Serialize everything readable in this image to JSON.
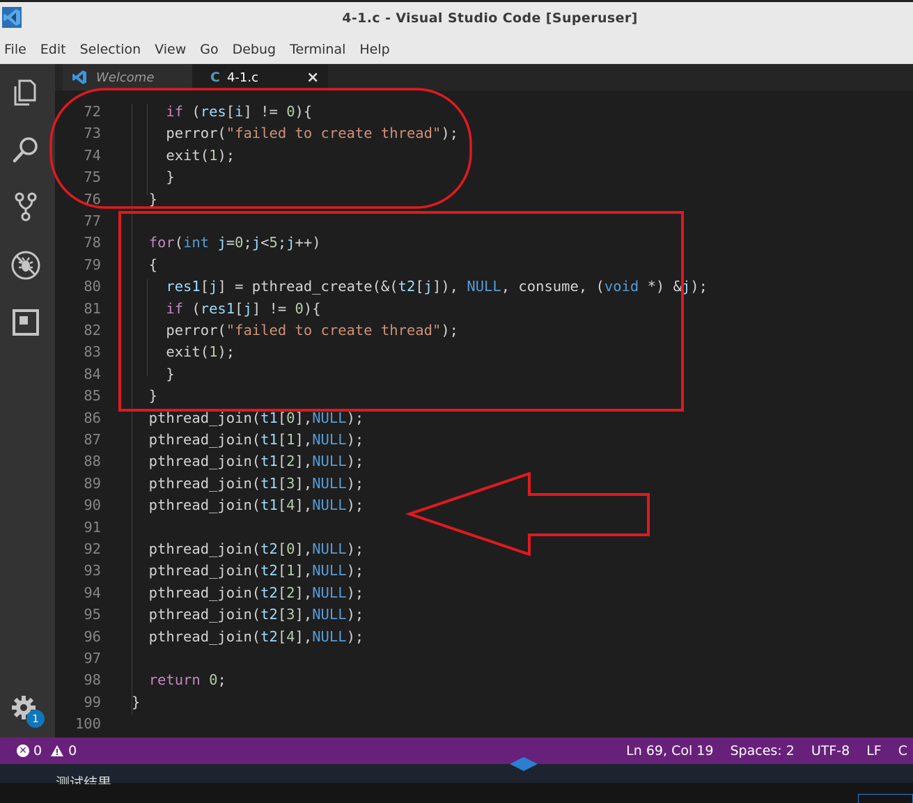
{
  "window": {
    "title": "4-1.c - Visual Studio Code [Superuser]"
  },
  "menu": [
    "File",
    "Edit",
    "Selection",
    "View",
    "Go",
    "Debug",
    "Terminal",
    "Help"
  ],
  "activity_bar": {
    "icons": [
      "files-icon",
      "search-icon",
      "source-control-icon",
      "debug-icon",
      "extensions-icon"
    ],
    "settings_badge": "1"
  },
  "tabs": [
    {
      "label": "Welcome",
      "icon": "vscode-logo-icon",
      "active": false
    },
    {
      "label": "4-1.c",
      "icon": "c-language-icon",
      "close": "×",
      "active": true
    }
  ],
  "editor": {
    "lines": [
      {
        "n": "72",
        "html": "    <span class=\"kw\">if</span> (<span class=\"var\">res</span>[<span class=\"var\">i</span>] != <span class=\"num\">0</span>){"
      },
      {
        "n": "73",
        "html": "    perror(<span class=\"str\">\"failed to create thread\"</span>);"
      },
      {
        "n": "74",
        "html": "    exit(<span class=\"num\">1</span>);"
      },
      {
        "n": "75",
        "html": "    }"
      },
      {
        "n": "76",
        "html": "  }"
      },
      {
        "n": "77",
        "html": ""
      },
      {
        "n": "78",
        "html": "  <span class=\"kw\">for</span>(<span class=\"ty\">int</span> <span class=\"var\">j</span>=<span class=\"num\">0</span>;<span class=\"var\">j</span>&lt;<span class=\"num\">5</span>;<span class=\"var\">j</span>++)"
      },
      {
        "n": "79",
        "html": "  {"
      },
      {
        "n": "80",
        "html": "    <span class=\"var\">res1</span>[<span class=\"var\">j</span>] = pthread_create(&amp;(<span class=\"var\">t2</span>[<span class=\"var\">j</span>]), <span class=\"nul\">NULL</span>, consume, (<span class=\"ty\">void</span> *) &amp;<span class=\"var\">j</span>);"
      },
      {
        "n": "81",
        "html": "    <span class=\"kw\">if</span> (<span class=\"var\">res1</span>[<span class=\"var\">j</span>] != <span class=\"num\">0</span>){"
      },
      {
        "n": "82",
        "html": "    perror(<span class=\"str\">\"failed to create thread\"</span>);"
      },
      {
        "n": "83",
        "html": "    exit(<span class=\"num\">1</span>);"
      },
      {
        "n": "84",
        "html": "    }"
      },
      {
        "n": "85",
        "html": "  }"
      },
      {
        "n": "86",
        "html": "  pthread_join(<span class=\"var\">t1</span>[<span class=\"num\">0</span>],<span class=\"nul\">NULL</span>);"
      },
      {
        "n": "87",
        "html": "  pthread_join(<span class=\"var\">t1</span>[<span class=\"num\">1</span>],<span class=\"nul\">NULL</span>);"
      },
      {
        "n": "88",
        "html": "  pthread_join(<span class=\"var\">t1</span>[<span class=\"num\">2</span>],<span class=\"nul\">NULL</span>);"
      },
      {
        "n": "89",
        "html": "  pthread_join(<span class=\"var\">t1</span>[<span class=\"num\">3</span>],<span class=\"nul\">NULL</span>);"
      },
      {
        "n": "90",
        "html": "  pthread_join(<span class=\"var\">t1</span>[<span class=\"num\">4</span>],<span class=\"nul\">NULL</span>);"
      },
      {
        "n": "91",
        "html": ""
      },
      {
        "n": "92",
        "html": "  pthread_join(<span class=\"var\">t2</span>[<span class=\"num\">0</span>],<span class=\"nul\">NULL</span>);"
      },
      {
        "n": "93",
        "html": "  pthread_join(<span class=\"var\">t2</span>[<span class=\"num\">1</span>],<span class=\"nul\">NULL</span>);"
      },
      {
        "n": "94",
        "html": "  pthread_join(<span class=\"var\">t2</span>[<span class=\"num\">2</span>],<span class=\"nul\">NULL</span>);"
      },
      {
        "n": "95",
        "html": "  pthread_join(<span class=\"var\">t2</span>[<span class=\"num\">3</span>],<span class=\"nul\">NULL</span>);"
      },
      {
        "n": "96",
        "html": "  pthread_join(<span class=\"var\">t2</span>[<span class=\"num\">4</span>],<span class=\"nul\">NULL</span>);"
      },
      {
        "n": "97",
        "html": ""
      },
      {
        "n": "98",
        "html": "  <span class=\"kw\">return</span> <span class=\"num\">0</span>;"
      },
      {
        "n": "99",
        "html": "}"
      },
      {
        "n": "100",
        "html": ""
      }
    ]
  },
  "status": {
    "errors": "0",
    "warnings": "0",
    "position": "Ln 69, Col 19",
    "spaces": "Spaces: 2",
    "encoding": "UTF-8",
    "eol": "LF",
    "language": "C"
  },
  "bottom_text": "测试结果",
  "colors": {
    "status_bar": "#68217a",
    "activity_bar": "#333333",
    "editor_bg": "#1e1e1e",
    "annotation": "#e0191f"
  }
}
